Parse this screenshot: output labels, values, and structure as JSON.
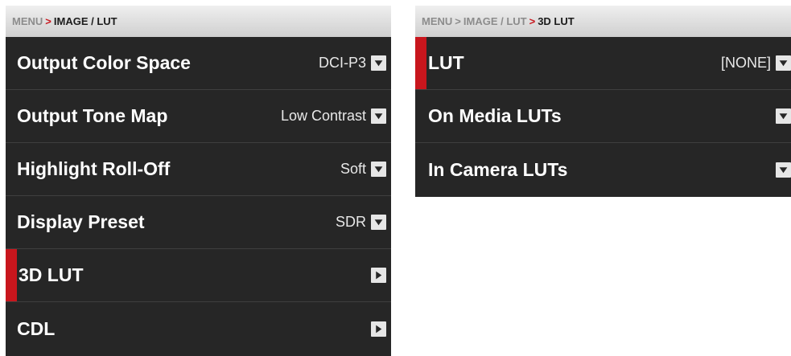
{
  "left_panel": {
    "breadcrumb": {
      "root": "MENU",
      "separator": ">",
      "current": "IMAGE / LUT"
    },
    "items": [
      {
        "label": "Output Color Space",
        "value": "DCI-P3",
        "control": "chevron-down-icon"
      },
      {
        "label": "Output Tone Map",
        "value": "Low Contrast",
        "control": "chevron-down-icon"
      },
      {
        "label": "Highlight Roll-Off",
        "value": "Soft",
        "control": "chevron-down-icon"
      },
      {
        "label": "Display Preset",
        "value": "SDR",
        "control": "chevron-down-icon"
      },
      {
        "label": "3D LUT",
        "value": "",
        "control": "chevron-right-icon",
        "selected": true
      },
      {
        "label": "CDL",
        "value": "",
        "control": "chevron-right-icon"
      }
    ]
  },
  "right_panel": {
    "breadcrumb": {
      "root": "MENU",
      "separator": ">",
      "middle": "IMAGE / LUT",
      "current": "3D LUT"
    },
    "items": [
      {
        "label": "LUT",
        "value": "[NONE]",
        "control": "chevron-down-icon",
        "selected": true
      },
      {
        "label": "On Media LUTs",
        "value": "",
        "control": "chevron-down-icon"
      },
      {
        "label": "In Camera LUTs",
        "value": "",
        "control": "chevron-down-icon"
      }
    ]
  },
  "colors": {
    "panel_background": "#262626",
    "accent_red": "#c8161d",
    "breadcrumb_background": "#dcdcdc",
    "text": "#ffffff"
  }
}
